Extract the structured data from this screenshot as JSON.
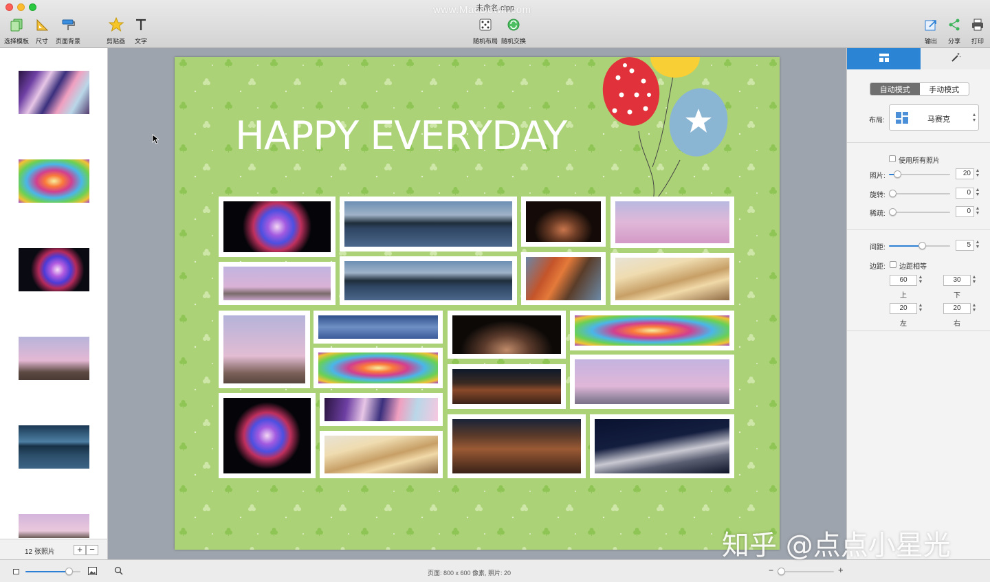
{
  "window": {
    "title": "未命名.clpp",
    "watermark": "www.MacDown.com"
  },
  "colors": {
    "accent": "#2b84d4",
    "canvas_bg": "#acd277",
    "title_text": "#ffffff"
  },
  "toolbar": {
    "left": [
      {
        "label": "选择模板",
        "icon": "template-icon"
      },
      {
        "label": "尺寸",
        "icon": "ruler-triangle-icon"
      },
      {
        "label": "页面背景",
        "icon": "paint-roller-icon"
      },
      {
        "label": "剪贴画",
        "icon": "star-icon"
      },
      {
        "label": "文字",
        "icon": "text-icon"
      }
    ],
    "center": [
      {
        "label": "随机布局",
        "icon": "dice-icon"
      },
      {
        "label": "随机交换",
        "icon": "shuffle-icon"
      }
    ],
    "right": [
      {
        "label": "输出",
        "icon": "export-icon"
      },
      {
        "label": "分享",
        "icon": "share-icon"
      },
      {
        "label": "打印",
        "icon": "print-icon"
      }
    ]
  },
  "sidebar": {
    "photo_count": "12 张照片",
    "add_label": "+",
    "remove_label": "−"
  },
  "canvas": {
    "title": "HAPPY EVERYDAY"
  },
  "inspector": {
    "mode_auto": "自动模式",
    "mode_manual": "手动模式",
    "layout_label": "布局:",
    "layout_value": "马赛克",
    "use_all_photos": "使用所有照片",
    "photos_label": "照片:",
    "photos_value": "20",
    "rotation_label": "旋转:",
    "rotation_value": "0",
    "sparse_label": "稀疏:",
    "sparse_value": "0",
    "spacing_label": "间距:",
    "spacing_value": "5",
    "margin_label": "边距:",
    "equal_margins": "边距相等",
    "margin_top_value": "60",
    "margin_top_label": "上",
    "margin_bottom_value": "30",
    "margin_bottom_label": "下",
    "margin_left_value": "20",
    "margin_left_label": "左",
    "margin_right_value": "20",
    "margin_right_label": "右",
    "stepper_up": "▲",
    "stepper_down": "▼"
  },
  "status": {
    "text": "页面: 800 x 600 像素, 照片: 20",
    "zoom_minus": "−",
    "zoom_plus": "+"
  },
  "overlay_watermark": "知乎 @点点小星光"
}
